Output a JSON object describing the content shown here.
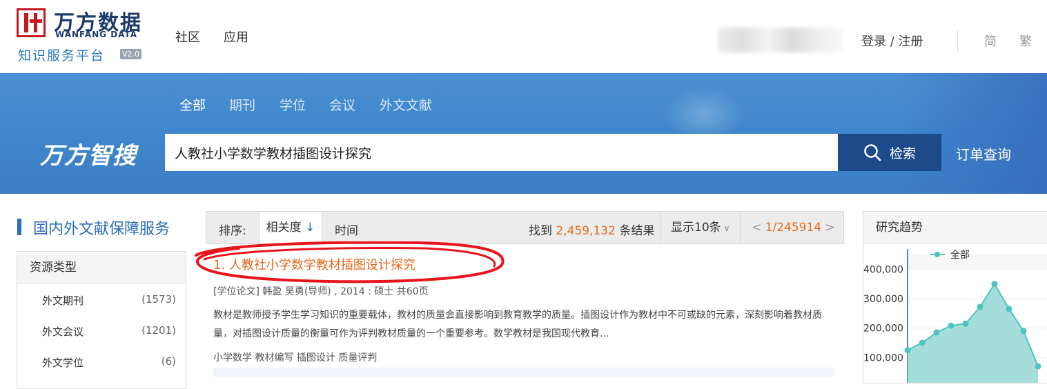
{
  "header": {
    "logo_cn": "万方数据",
    "logo_en": "WANFANG DATA",
    "platform": "知识服务平台",
    "version": "V2.0",
    "nav": [
      "社区",
      "应用"
    ],
    "login": "登录 / 注册",
    "lang_simplified": "简",
    "lang_traditional": "繁"
  },
  "banner": {
    "tabs": [
      "全部",
      "期刊",
      "学位",
      "会议",
      "外文文献"
    ],
    "active_tab": "全部",
    "brand": "万方智搜",
    "search_value": "人教社小学数学教材插图设计探究",
    "search_button": "检索",
    "order_query": "订单查询"
  },
  "sidebar": {
    "title": "国内外文献保障服务",
    "section_title": "资源类型",
    "items": [
      {
        "label": "外文期刊",
        "count": "(1573)"
      },
      {
        "label": "外文会议",
        "count": "(1201)"
      },
      {
        "label": "外文学位",
        "count": "(6)"
      }
    ]
  },
  "sortbar": {
    "label": "排序:",
    "relevance": "相关度",
    "relevance_arrow": "↓",
    "time": "时间",
    "found_prefix": "找到",
    "found_count": "2,459,132",
    "found_suffix": "条结果",
    "show": "显示10条",
    "pager_prev": "<",
    "pager_current": "1",
    "pager_total": "/245914",
    "pager_next": ">"
  },
  "result": {
    "index": "1.",
    "title": "人教社小学数学教材插图设计探究",
    "meta": "[学位论文]   韩盈  吴勇(导师) ,  2014   :     硕士     共60页",
    "abstract": "教材是教师授予学生学习知识的重要载体，教材的质量会直接影响到教育教学的质量。插图设计作为教材中不可或缺的元素，深刻影响着教材质量，对插图设计质量的衡量可作为评判教材质量的一个重要参考。数学教材是我国现代教育...",
    "keywords": "小学数学  教材编写  插图设计  质量评判"
  },
  "trend": {
    "title": "研究趋势",
    "legend": "全部",
    "line_color": "#4cc4c0",
    "fill_color": "#9ad9d6",
    "y_ticks": [
      "400,000",
      "300,000",
      "200,000",
      "100,000"
    ]
  },
  "chart_data": {
    "type": "area",
    "title": "研究趋势",
    "series": [
      {
        "name": "全部",
        "values": [
          125000,
          150000,
          185000,
          208000,
          215000,
          272000,
          350000,
          265000,
          190000,
          70000
        ]
      }
    ],
    "ylim": [
      0,
      450000
    ],
    "y_ticks": [
      100000,
      200000,
      300000,
      400000
    ],
    "grid": true,
    "legend": "top"
  }
}
